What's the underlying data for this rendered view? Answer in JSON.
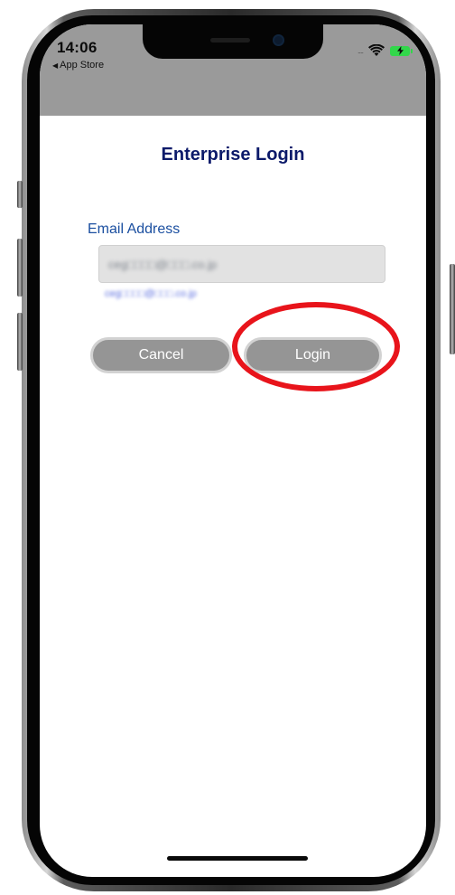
{
  "status_bar": {
    "time": "14:06",
    "back_label": "App Store",
    "signal_dots": "....",
    "battery_charging": true
  },
  "login": {
    "title": "Enterprise Login",
    "email_label": "Email Address",
    "email_value": "ceg□□□□@□□□.co.jp",
    "email_hint": "ceg□□□□@□□□.co.jp",
    "cancel_label": "Cancel",
    "login_label": "Login"
  },
  "colors": {
    "title": "#0c1a6a",
    "label": "#1b4fa0",
    "button_bg": "#959595",
    "highlight": "#e8141b",
    "status_bg": "#9a9a9a",
    "battery": "#32d74b"
  },
  "icons": [
    "wifi-icon",
    "battery-charging-icon",
    "back-triangle-icon"
  ]
}
